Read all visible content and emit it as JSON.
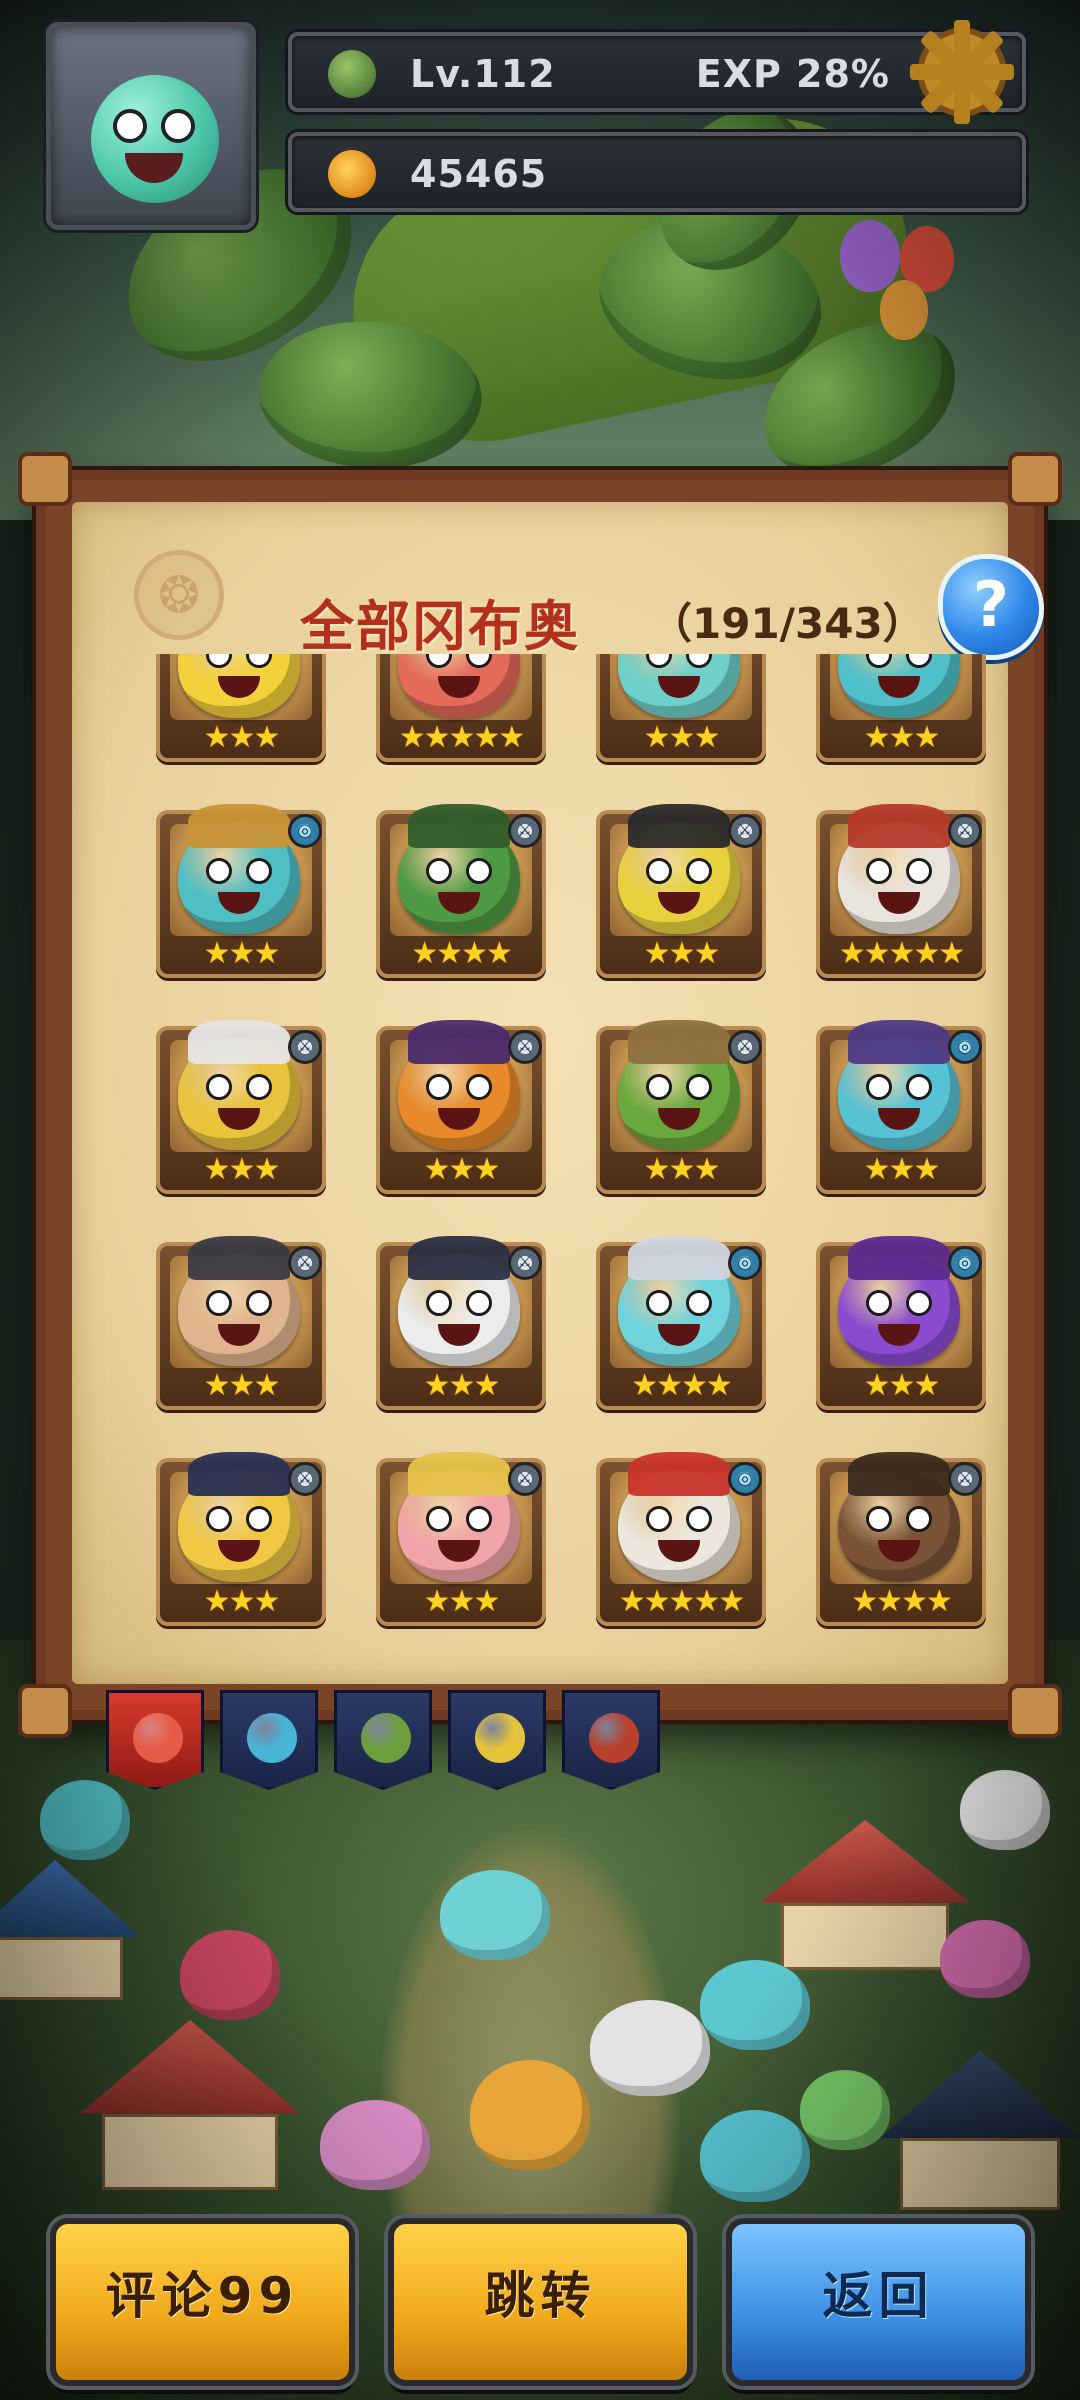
{
  "hud": {
    "level_text": "Lv.112",
    "exp_text": "EXP 28%",
    "gold_amount": "45465"
  },
  "panel": {
    "title": "全部冈布奥",
    "count": "（191/343）",
    "help_label": "?"
  },
  "monsters": [
    {
      "stars": 3,
      "color": "#f3d13a",
      "hat": "#c9b14a",
      "badge": ""
    },
    {
      "stars": 5,
      "color": "#e46a5a",
      "hat": "#5f8fc4",
      "badge": ""
    },
    {
      "stars": 3,
      "color": "#6ed0c8",
      "hat": "#c43b36",
      "badge": ""
    },
    {
      "stars": 3,
      "color": "#4fc0c8",
      "hat": "#5b3a2a",
      "badge": ""
    },
    {
      "stars": 3,
      "color": "#4fbfc4",
      "hat": "#c99235",
      "badge": "mage"
    },
    {
      "stars": 4,
      "color": "#4f9a44",
      "hat": "#2f5d2a",
      "badge": "warrior"
    },
    {
      "stars": 3,
      "color": "#e7d23e",
      "hat": "#2a2a2a",
      "badge": "warrior"
    },
    {
      "stars": 5,
      "color": "#e9e4dc",
      "hat": "#b5392b",
      "badge": "warrior"
    },
    {
      "stars": 3,
      "color": "#e8c33b",
      "hat": "#e6e6e6",
      "badge": "warrior"
    },
    {
      "stars": 3,
      "color": "#e88a2a",
      "hat": "#4a2b6b",
      "badge": "warrior"
    },
    {
      "stars": 3,
      "color": "#68a83c",
      "hat": "#8e7040",
      "badge": "warrior"
    },
    {
      "stars": 3,
      "color": "#56c2d4",
      "hat": "#4e3a86",
      "badge": "mage"
    },
    {
      "stars": 3,
      "color": "#e0b48c",
      "hat": "#3a3a42",
      "badge": "warrior"
    },
    {
      "stars": 3,
      "color": "#ececec",
      "hat": "#2b2f45",
      "badge": "warrior"
    },
    {
      "stars": 4,
      "color": "#6fd3dc",
      "hat": "#cfd5de",
      "badge": "mage"
    },
    {
      "stars": 3,
      "color": "#8a4bd0",
      "hat": "#5a2a8e",
      "badge": "mage"
    },
    {
      "stars": 3,
      "color": "#f0c843",
      "hat": "#2a2f52",
      "badge": "warrior"
    },
    {
      "stars": 3,
      "color": "#f2a5a8",
      "hat": "#e6c24a",
      "badge": "warrior"
    },
    {
      "stars": 5,
      "color": "#ece6dc",
      "hat": "#c8342c",
      "badge": "mage"
    },
    {
      "stars": 4,
      "color": "#7a5236",
      "hat": "#3a2a1e",
      "badge": "warrior"
    }
  ],
  "tabs": [
    {
      "name": "tab-all",
      "color": "#e85a48",
      "active": true
    },
    {
      "name": "tab-cyan",
      "color": "#48b4d6",
      "active": false
    },
    {
      "name": "tab-green",
      "color": "#6c9e3c",
      "active": false
    },
    {
      "name": "tab-yellow",
      "color": "#e6c43a",
      "active": false
    },
    {
      "name": "tab-red",
      "color": "#b8402c",
      "active": false
    }
  ],
  "buttons": {
    "comment_label": "评论99",
    "jump_label": "跳转",
    "back_label": "返回"
  }
}
